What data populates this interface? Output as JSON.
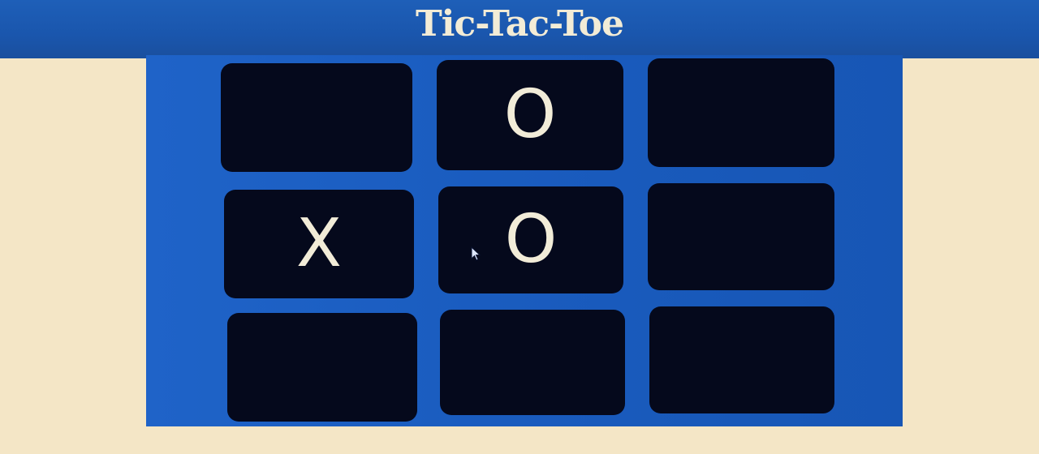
{
  "header": {
    "title": "Tic-Tac-Toe"
  },
  "board": {
    "cells": [
      {
        "value": ""
      },
      {
        "value": "O"
      },
      {
        "value": ""
      },
      {
        "value": "X"
      },
      {
        "value": "O"
      },
      {
        "value": ""
      },
      {
        "value": ""
      },
      {
        "value": ""
      },
      {
        "value": ""
      }
    ]
  },
  "colors": {
    "page_background": "#f4e6c6",
    "header_background": "#1a56ad",
    "board_background": "#1a5cbf",
    "cell_background": "#05091c",
    "mark_color": "#f2ecd8"
  },
  "icons": {
    "cursor": "mouse-pointer-icon"
  }
}
